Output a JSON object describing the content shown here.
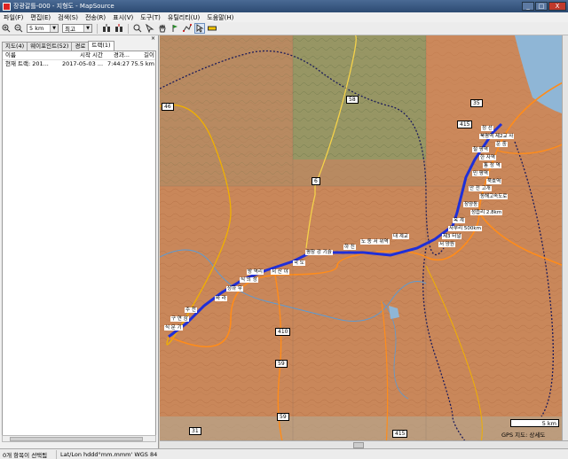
{
  "window": {
    "title": "장광갈틀-000 - 지형도 - MapSource",
    "buttons": [
      "_",
      "□",
      "X"
    ]
  },
  "menu": [
    "파일(F)",
    "편집(E)",
    "검색(S)",
    "전송(R)",
    "표시(V)",
    "도구(T)",
    "유틸리티(U)",
    "도움말(H)"
  ],
  "toolbar": {
    "scale_value": "5 km",
    "detail_value": "최고"
  },
  "panel": {
    "tabs": [
      "지도(4)",
      "웨이포인트(52)",
      "경로",
      "트랙(1)"
    ],
    "columns": [
      "이름",
      "시작 시간",
      "경과...",
      "길이"
    ],
    "rows": [
      {
        "name": "현재 트랙: 201...",
        "start": "2017-05-03 ...",
        "elapsed": "7:44:27",
        "length": "75.5 km"
      }
    ]
  },
  "map": {
    "road_labels": [
      "58",
      "6",
      "59",
      "59",
      "410",
      "415",
      "415",
      "31",
      "35",
      "46"
    ],
    "waypoint_labels": [
      "정 선",
      "북평역 제2교 사",
      "운 중",
      "철 평역",
      "한 자역",
      "통 정 역",
      "민 평역",
      "묵호역",
      "안 전 고개",
      "동해고속도로",
      "장양동",
      "성읍리 2.8km",
      "옥 계",
      "사부리 500km",
      "대 계교",
      "제3 터널",
      "서 양원",
      "노 동 서 위역",
      "평창 강 기슭",
      "하 진",
      "국 도",
      "서 산 야",
      "방 역리",
      "식 의 정",
      "상하 무",
      "바 라",
      "주 천",
      "구 연 삼",
      "식 문 기"
    ],
    "scale_label": "5 km",
    "copyright": "GPS 지도: 상세도"
  },
  "status": {
    "selection": "0개 항목이 선택됨",
    "coord_format": "Lat/Lon hddd°mm.mmm' WGS 84"
  },
  "colors": {
    "terrain": "#c9875a",
    "forest": "#8c9a66",
    "track": "#1f2fd8",
    "road": "#ff8c1a"
  }
}
